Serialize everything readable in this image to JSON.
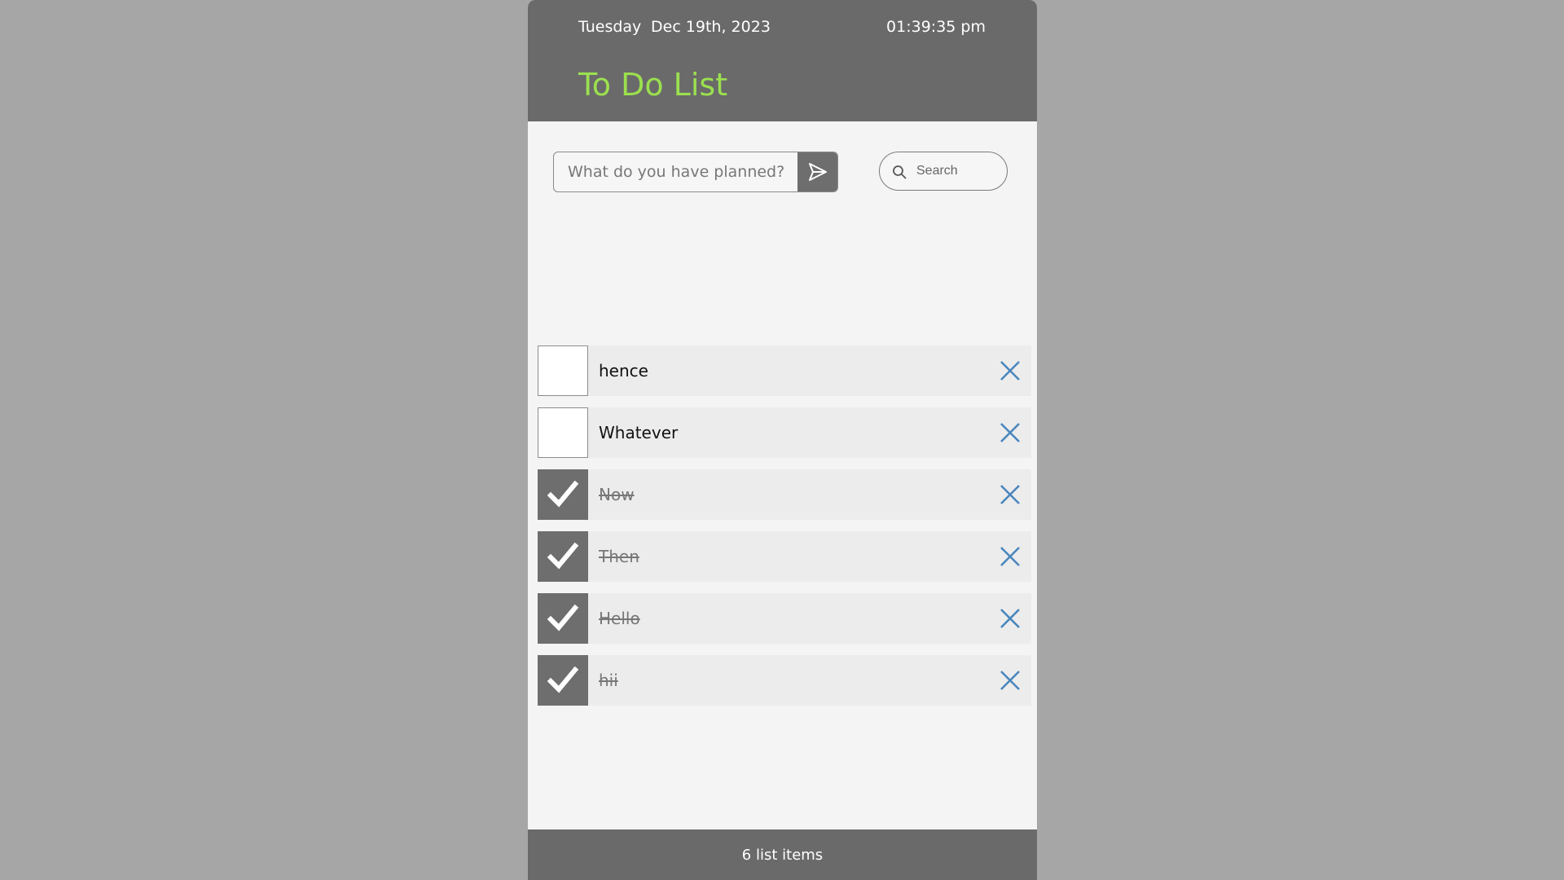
{
  "header": {
    "day": "Tuesday",
    "date": "Dec 19th, 2023",
    "time": "01:39:35 pm",
    "title": "To Do List",
    "title_color": "#9be04f"
  },
  "task_input": {
    "value": "",
    "placeholder": "What do you have planned?",
    "send_icon": "send-icon"
  },
  "search": {
    "value": "",
    "placeholder": "Search",
    "icon": "search-icon"
  },
  "items": [
    {
      "label": "hence",
      "completed": false
    },
    {
      "label": "Whatever",
      "completed": false
    },
    {
      "label": "Now",
      "completed": true
    },
    {
      "label": "Then",
      "completed": true
    },
    {
      "label": "Hello",
      "completed": true
    },
    {
      "label": "hii",
      "completed": true
    }
  ],
  "footer": {
    "count_text": "6 list items"
  },
  "colors": {
    "header_bg": "#6a6a6a",
    "page_bg": "#a6a6a6",
    "delete_icon": "#4a86bd",
    "checked_bg": "#6e6e6e"
  }
}
